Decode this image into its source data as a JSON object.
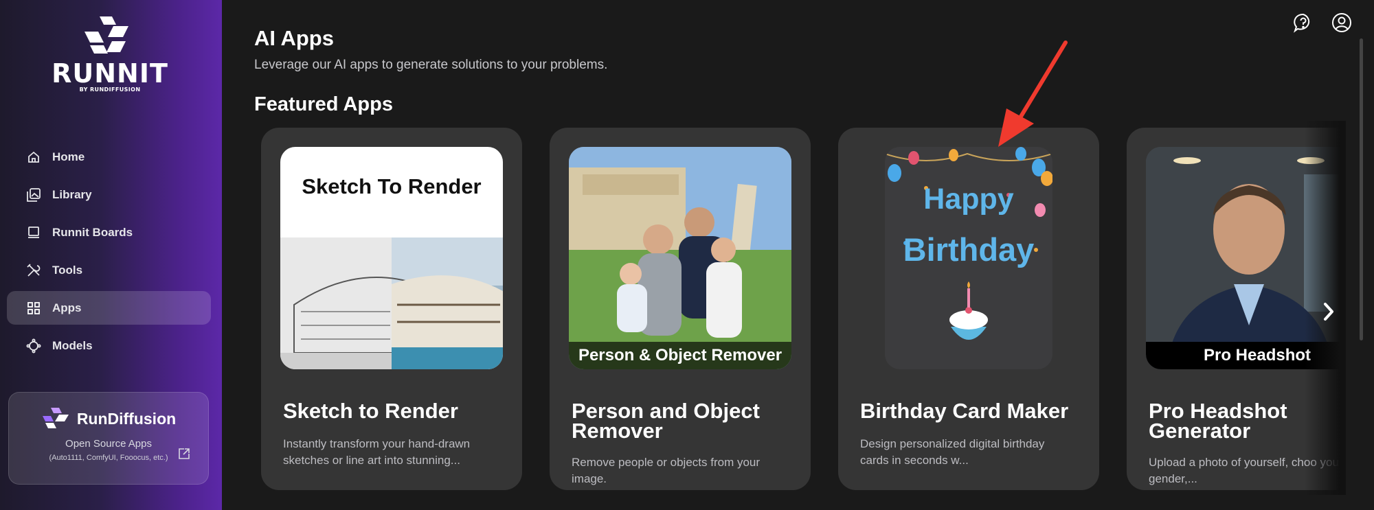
{
  "brand": {
    "name": "RUNNIT",
    "byline": "BY RUNDIFFUSION"
  },
  "sidebar": {
    "items": [
      {
        "label": "Home",
        "icon": "home-icon",
        "active": false
      },
      {
        "label": "Library",
        "icon": "library-icon",
        "active": false
      },
      {
        "label": "Runnit Boards",
        "icon": "boards-icon",
        "active": false
      },
      {
        "label": "Tools",
        "icon": "tools-icon",
        "active": false
      },
      {
        "label": "Apps",
        "icon": "apps-grid-icon",
        "active": true
      },
      {
        "label": "Models",
        "icon": "models-icon",
        "active": false
      }
    ],
    "promo": {
      "title": "RunDiffusion",
      "link": "Open Source Apps",
      "sub": "(Auto1111, ComfyUI, Fooocus, etc.)"
    }
  },
  "header": {
    "title": "AI Apps",
    "subtitle": "Leverage our AI apps to generate solutions to your problems."
  },
  "featured": {
    "title": "Featured Apps",
    "cards": [
      {
        "title": "Sketch to Render",
        "desc": "Instantly transform your hand-drawn sketches or line art into stunning...",
        "image_text": "Sketch To Render"
      },
      {
        "title": "Person and Object Remover",
        "desc": "Remove people or objects from your image.",
        "image_text": "Person & Object Remover"
      },
      {
        "title": "Birthday Card Maker",
        "desc": "Design personalized digital birthday cards in seconds w...",
        "image_text_1": "Happy",
        "image_text_2": "Birthday"
      },
      {
        "title": "Pro Headshot Generator",
        "desc": "Upload a photo of yourself, choo your outfit, gender,...",
        "image_text": "Pro Headshot"
      }
    ]
  },
  "colors": {
    "sidebar_accent": "#5c28a8",
    "card_bg": "#353535",
    "page_bg": "#1a1a1a",
    "annotation_arrow": "#f03a2e"
  }
}
